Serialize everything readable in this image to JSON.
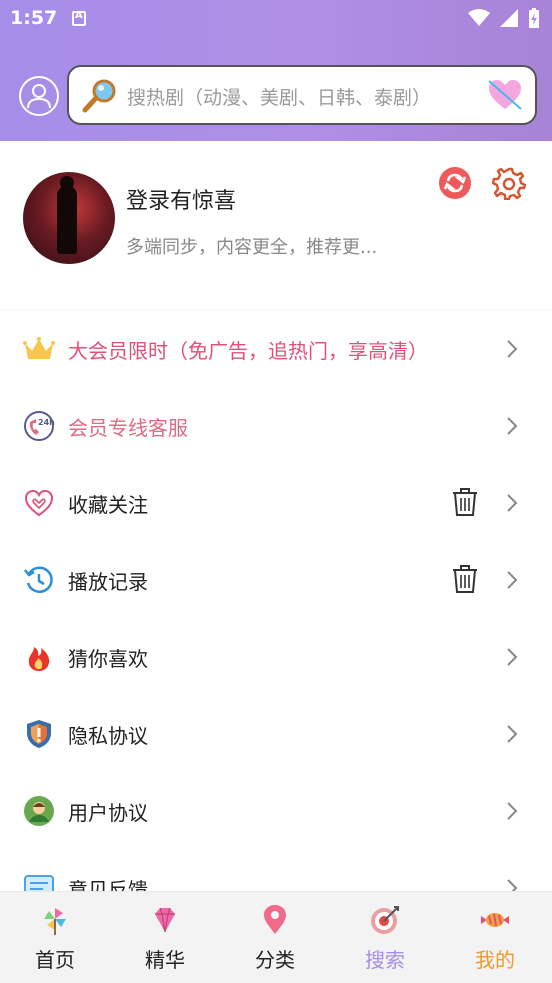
{
  "status_bar": {
    "time": "1:57"
  },
  "search": {
    "placeholder": "搜热剧（动漫、美剧、日韩、泰剧）"
  },
  "profile": {
    "title": "登录有惊喜",
    "subtitle": "多端同步，内容更全，推荐更..."
  },
  "menu": {
    "items": [
      {
        "label": "大会员限时（免广告，追热门，享高清）",
        "icon": "crown-icon"
      },
      {
        "label": "会员专线客服",
        "icon": "24h-service-icon"
      },
      {
        "label": "收藏关注",
        "icon": "heart-outline-icon"
      },
      {
        "label": "播放记录",
        "icon": "history-icon"
      },
      {
        "label": "猜你喜欢",
        "icon": "flame-icon"
      },
      {
        "label": "隐私协议",
        "icon": "shield-icon"
      },
      {
        "label": "用户协议",
        "icon": "user-icon"
      },
      {
        "label": "意见反馈",
        "icon": "feedback-icon"
      }
    ]
  },
  "bottom_nav": {
    "items": [
      {
        "label": "首页",
        "icon": "pinwheel-icon",
        "color": "#222222"
      },
      {
        "label": "精华",
        "icon": "diamond-icon",
        "color": "#222222"
      },
      {
        "label": "分类",
        "icon": "location-pin-icon",
        "color": "#222222"
      },
      {
        "label": "搜索",
        "icon": "target-icon",
        "color": "#a58ee8"
      },
      {
        "label": "我的",
        "icon": "candy-icon",
        "color": "#f09a2a"
      }
    ]
  },
  "colors": {
    "header_start": "#a58ee8",
    "header_end": "#a883d6",
    "accent_pink": "#e0507a",
    "active_tab": "#f09a2a"
  }
}
